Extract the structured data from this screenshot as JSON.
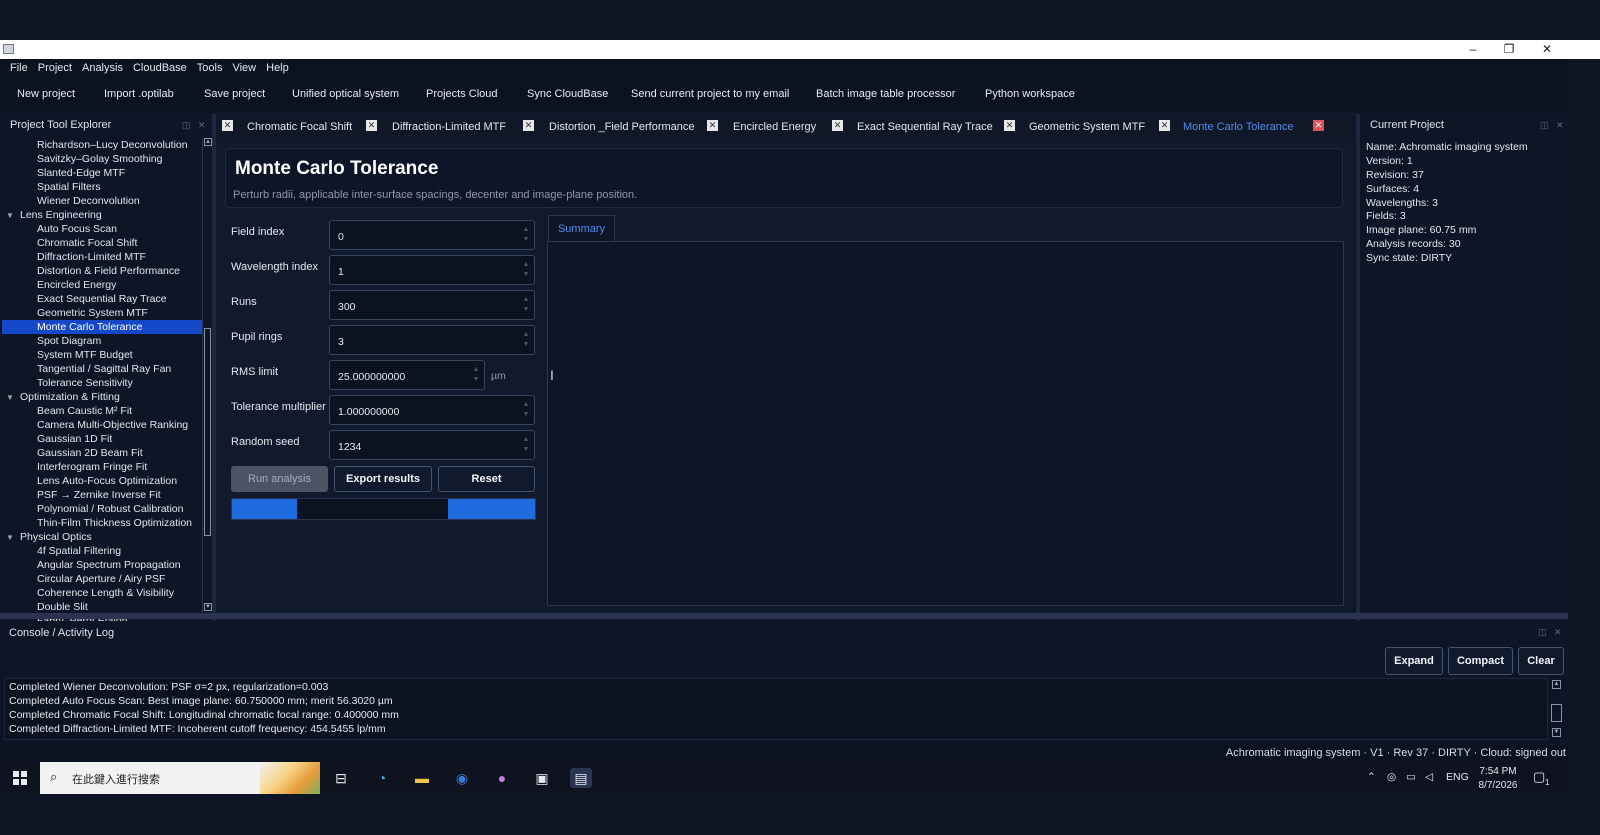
{
  "window": {
    "minimize": "–",
    "maximize": "❐",
    "close": "✕"
  },
  "menu": [
    "File",
    "Project",
    "Analysis",
    "CloudBase",
    "Tools",
    "View",
    "Help"
  ],
  "toolbar": [
    "New project",
    "Import .optilab",
    "Save project",
    "Unified optical system",
    "Projects  Cloud",
    "Sync CloudBase",
    "Send current project to my email",
    "Batch image  table processor",
    "Python workspace"
  ],
  "left_panel": {
    "title": "Project  Tool Explorer",
    "items": [
      {
        "type": "child",
        "label": "Richardson–Lucy Deconvolution"
      },
      {
        "type": "child",
        "label": "Savitzky–Golay Smoothing"
      },
      {
        "type": "child",
        "label": "Slanted-Edge MTF"
      },
      {
        "type": "child",
        "label": "Spatial Filters"
      },
      {
        "type": "child",
        "label": "Wiener Deconvolution"
      },
      {
        "type": "group",
        "label": "Lens Engineering"
      },
      {
        "type": "child",
        "label": "Auto Focus Scan"
      },
      {
        "type": "child",
        "label": "Chromatic Focal Shift"
      },
      {
        "type": "child",
        "label": "Diffraction-Limited MTF"
      },
      {
        "type": "child",
        "label": "Distortion & Field Performance"
      },
      {
        "type": "child",
        "label": "Encircled Energy"
      },
      {
        "type": "child",
        "label": "Exact Sequential Ray Trace"
      },
      {
        "type": "child",
        "label": "Geometric System MTF"
      },
      {
        "type": "child",
        "label": "Monte Carlo Tolerance",
        "selected": true
      },
      {
        "type": "child",
        "label": "Spot Diagram"
      },
      {
        "type": "child",
        "label": "System MTF Budget"
      },
      {
        "type": "child",
        "label": "Tangential / Sagittal Ray Fan"
      },
      {
        "type": "child",
        "label": "Tolerance Sensitivity"
      },
      {
        "type": "group",
        "label": "Optimization & Fitting"
      },
      {
        "type": "child",
        "label": "Beam Caustic M² Fit"
      },
      {
        "type": "child",
        "label": "Camera Multi-Objective Ranking"
      },
      {
        "type": "child",
        "label": "Gaussian 1D Fit"
      },
      {
        "type": "child",
        "label": "Gaussian 2D Beam Fit"
      },
      {
        "type": "child",
        "label": "Interferogram Fringe Fit"
      },
      {
        "type": "child",
        "label": "Lens Auto-Focus Optimization"
      },
      {
        "type": "child",
        "label": "PSF → Zernike Inverse Fit"
      },
      {
        "type": "child",
        "label": "Polynomial / Robust Calibration"
      },
      {
        "type": "child",
        "label": "Thin-Film Thickness Optimization"
      },
      {
        "type": "group",
        "label": "Physical Optics"
      },
      {
        "type": "child",
        "label": "4f Spatial Filtering"
      },
      {
        "type": "child",
        "label": "Angular Spectrum Propagation"
      },
      {
        "type": "child",
        "label": "Circular Aperture / Airy PSF"
      },
      {
        "type": "child",
        "label": "Coherence Length & Visibility"
      },
      {
        "type": "child",
        "label": "Double Slit"
      },
      {
        "type": "child",
        "label": "Fabry–Pérot Etalon"
      }
    ]
  },
  "tabs": [
    {
      "label": "Chromatic Focal Shift"
    },
    {
      "label": "Diffraction-Limited MTF"
    },
    {
      "label": "Distortion _Field Performance"
    },
    {
      "label": "Encircled Energy"
    },
    {
      "label": "Exact Sequential Ray Trace"
    },
    {
      "label": "Geometric System MTF"
    },
    {
      "label": "Monte Carlo Tolerance",
      "active": true
    }
  ],
  "header": {
    "title": "Monte Carlo Tolerance",
    "subtitle": "Perturb radii, applicable inter-surface spacings, decenter and image-plane position."
  },
  "form": [
    {
      "label": "Field index",
      "value": "0"
    },
    {
      "label": "Wavelength index",
      "value": "1"
    },
    {
      "label": "Runs",
      "value": "300"
    },
    {
      "label": "Pupil rings",
      "value": "3"
    },
    {
      "label": "RMS limit",
      "value": "25.000000000",
      "unit": "µm"
    },
    {
      "label": "Tolerance multiplier",
      "value": "1.000000000"
    },
    {
      "label": "Random seed",
      "value": "1234"
    }
  ],
  "buttons": {
    "run": "Run analysis",
    "export": "Export results",
    "reset": "Reset"
  },
  "summary_tab": "Summary",
  "current_project": {
    "title": "Current Project",
    "lines": [
      "Name: Achromatic imaging system",
      "Version: 1",
      "Revision: 37",
      "Surfaces: 4",
      "Wavelengths: 3",
      "Fields: 3",
      "Image plane: 60.75 mm",
      "Analysis records: 30",
      "Sync state: DIRTY"
    ]
  },
  "console": {
    "title": "Console / Activity Log",
    "buttons": [
      "Expand",
      "Compact",
      "Clear"
    ],
    "lines": [
      "Completed Wiener Deconvolution: PSF σ=2 px, regularization=0.003",
      "Completed Auto Focus Scan: Best image plane: 60.750000 mm; merit 56.3020 µm",
      "Completed Chromatic Focal Shift: Longitudinal chromatic focal range: 0.400000 mm",
      "Completed Diffraction-Limited MTF: Incoherent cutoff frequency: 454.5455 lp/mm"
    ]
  },
  "status": "Achromatic imaging system · V1 · Rev 37 · DIRTY · Cloud: signed out",
  "taskbar": {
    "search_placeholder": "在此鍵入進行搜索",
    "lang": "ENG",
    "time": "7:54 PM",
    "date": "8/7/2026",
    "notif_count": "1"
  },
  "colors": {
    "accent": "#1e6be0",
    "selection": "#1547c9",
    "active_tab": "#4d8df0",
    "background": "#0d1526"
  }
}
